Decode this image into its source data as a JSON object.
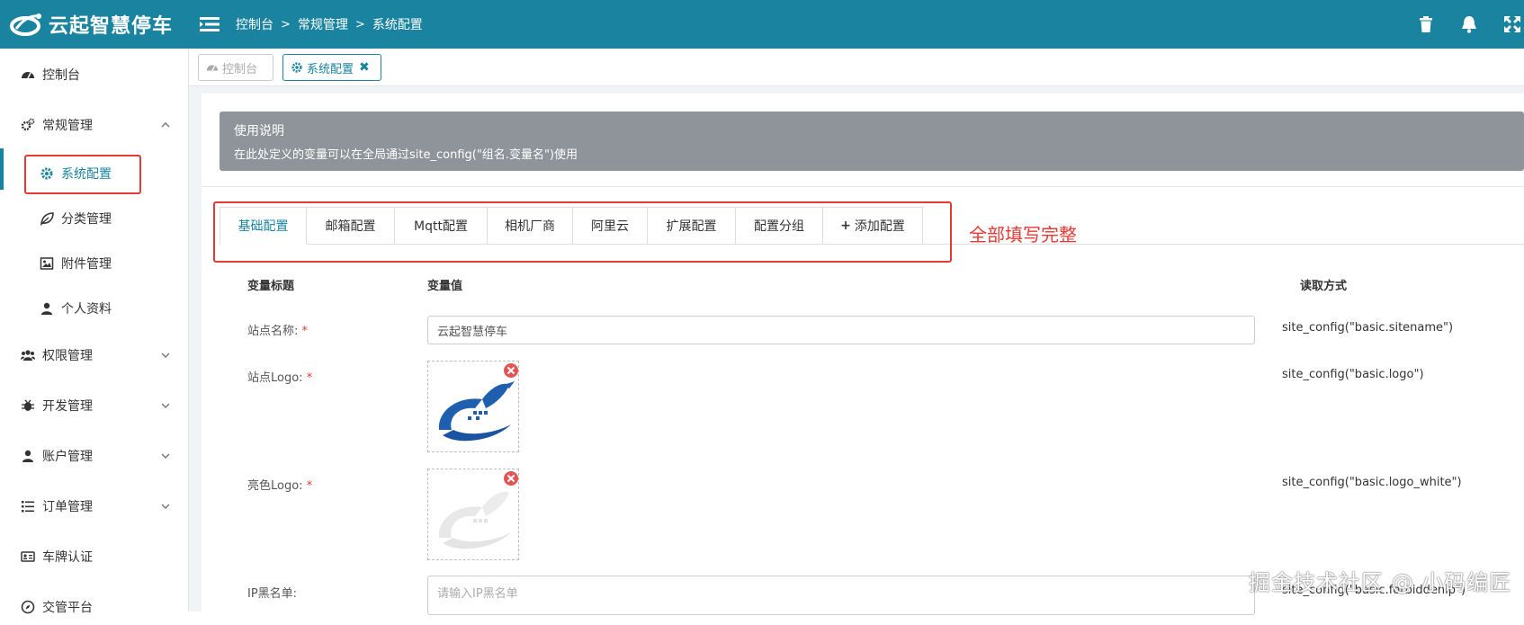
{
  "header": {
    "brand": "云起智慧停车",
    "breadcrumb": [
      "控制台",
      "常规管理",
      "系统配置"
    ],
    "bg_color": "#1a839f",
    "icons": [
      "trash-icon",
      "bell-icon",
      "fullscreen-icon"
    ]
  },
  "sidebar": {
    "items": [
      {
        "label": "控制台",
        "icon": "dashboard-icon"
      },
      {
        "label": "常规管理",
        "icon": "cogs-icon"
      },
      {
        "label": "系统配置",
        "icon": "gear-icon"
      },
      {
        "label": "分类管理",
        "icon": "leaf-icon"
      },
      {
        "label": "附件管理",
        "icon": "image-icon"
      },
      {
        "label": "个人资料",
        "icon": "user-icon"
      },
      {
        "label": "权限管理",
        "icon": "group-icon"
      },
      {
        "label": "开发管理",
        "icon": "bug-icon"
      },
      {
        "label": "账户管理",
        "icon": "user-icon"
      },
      {
        "label": "订单管理",
        "icon": "list-icon"
      },
      {
        "label": "车牌认证",
        "icon": "id-card-icon"
      },
      {
        "label": "交管平台",
        "icon": "compass-icon"
      }
    ],
    "active": "系统配置"
  },
  "page_tabs": [
    {
      "label": "控制台",
      "state": "inactive"
    },
    {
      "label": "系统配置",
      "state": "current"
    }
  ],
  "notice": {
    "title": "使用说明",
    "desc": "在此处定义的变量可以在全局通过site_config(\"组名.变量名\")使用"
  },
  "config_tabs": [
    "基础配置",
    "邮箱配置",
    "Mqtt配置",
    "相机厂商",
    "阿里云",
    "扩展配置",
    "配置分组",
    "添加配置"
  ],
  "annotation": "全部填写完整",
  "table": {
    "headers": {
      "title": "变量标题",
      "value": "变量值",
      "read": "读取方式"
    },
    "rows": [
      {
        "label": "站点名称:",
        "value": "云起智慧停车",
        "read": "site_config(\"basic.sitename\")"
      },
      {
        "label": "站点Logo:",
        "read": "site_config(\"basic.logo\")"
      },
      {
        "label": "亮色Logo:",
        "read": "site_config(\"basic.logo_white\")"
      },
      {
        "label": "IP黑名单:",
        "placeholder": "请输入IP黑名单",
        "read": "site_config(\"basic.forbiddenip\")"
      }
    ]
  },
  "watermark": "掘金技术社区 @ 小码编匠",
  "colors": {
    "accent": "#1a839f",
    "highlight": "#e53935",
    "notice_bg": "#8f949a"
  }
}
